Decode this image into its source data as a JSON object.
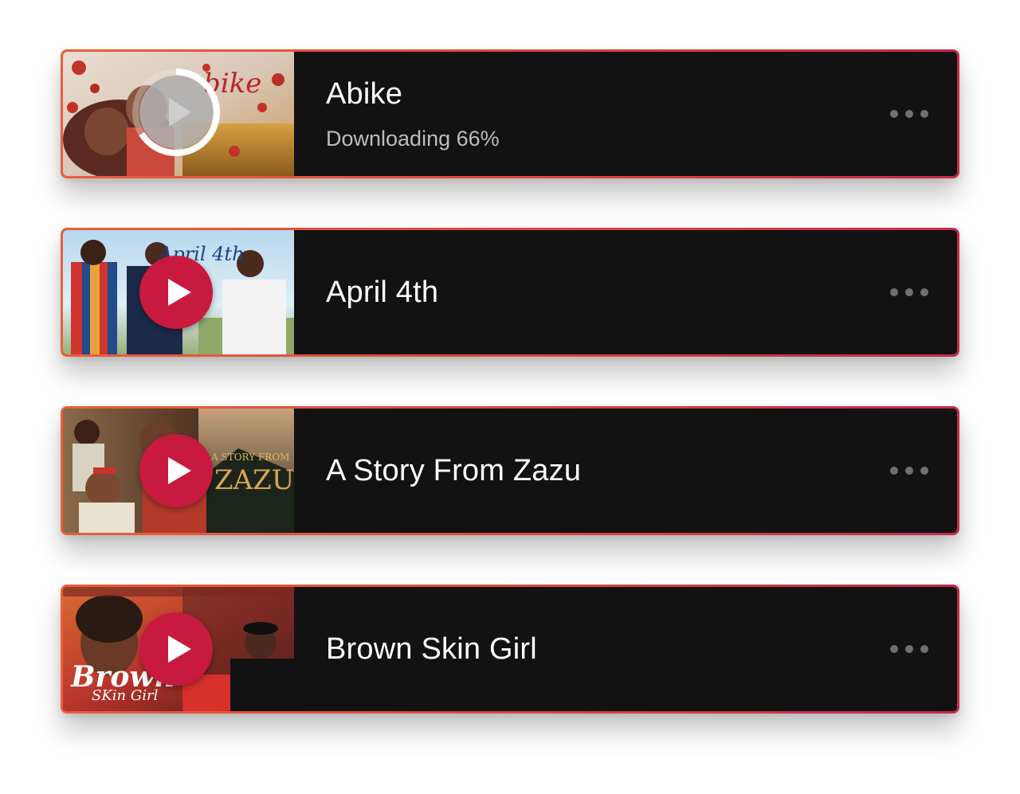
{
  "downloads": {
    "items": [
      {
        "title": "Abike",
        "status": "Downloading 66%",
        "progress": 0.66,
        "state": "downloading",
        "poster_text": "bike"
      },
      {
        "title": "April 4th",
        "state": "ready",
        "poster_text": "April 4th"
      },
      {
        "title": "A Story From Zazu",
        "state": "ready",
        "poster_text": "A STORY FROM",
        "poster_text_2": "ZAZU"
      },
      {
        "title": "Brown Skin Girl",
        "state": "ready",
        "poster_text": "Brown",
        "poster_text_2": "SKin Girl"
      }
    ]
  },
  "colors": {
    "card_border_start": "#e8603a",
    "card_border_end": "#c52a4a",
    "card_background": "#121213",
    "play_button": "#c8193f",
    "title_text": "#ffffff",
    "status_text": "#bdbdbd",
    "more_dots": "#707072"
  },
  "icons": {
    "play": "play-icon",
    "progress": "download-progress-ring",
    "more": "more-options-icon"
  }
}
